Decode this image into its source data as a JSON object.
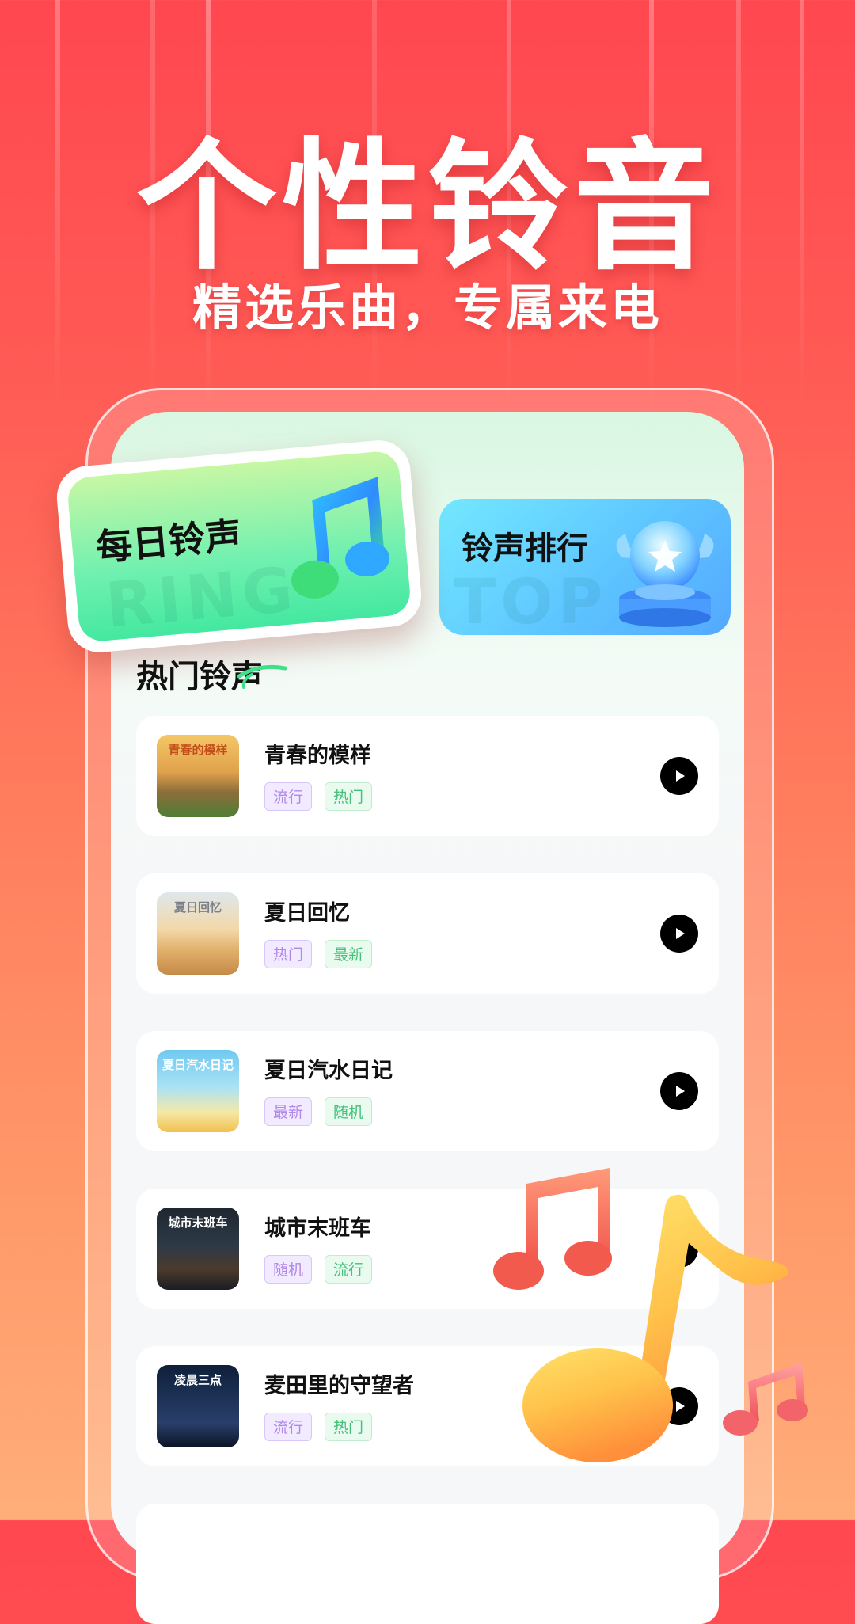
{
  "hero": {
    "title": "个性铃音",
    "subtitle": "精选乐曲，专属来电"
  },
  "cards": {
    "daily": {
      "title": "每日铃声",
      "watermark": "RING",
      "icon": "music-note-icon"
    },
    "ranking": {
      "title": "铃声排行",
      "watermark": "TOP",
      "icon": "trophy-icon"
    }
  },
  "section": {
    "title": "热门铃声"
  },
  "songs": [
    {
      "name": "青春的模样",
      "cover_caption": "青春的模样",
      "tags": [
        "流行",
        "热门"
      ]
    },
    {
      "name": "夏日回忆",
      "cover_caption": "夏日回忆",
      "tags": [
        "热门",
        "最新"
      ]
    },
    {
      "name": "夏日汽水日记",
      "cover_caption": "夏日汽水日记",
      "tags": [
        "最新",
        "随机"
      ]
    },
    {
      "name": "城市末班车",
      "cover_caption": "城市末班车",
      "tags": [
        "随机",
        "流行"
      ]
    },
    {
      "name": "麦田里的守望者",
      "cover_caption": "凌晨三点",
      "tags": [
        "流行",
        "热门"
      ]
    }
  ],
  "icons": {
    "play": "play-icon",
    "decor_note_large": "music-note-icon",
    "decor_note_red": "double-music-note-icon",
    "decor_note_small": "double-music-note-icon"
  },
  "colors": {
    "background_top": "#ff4750",
    "background_bottom": "#ffae7a",
    "tag_purple": "#b088e8",
    "tag_green": "#44c07a"
  }
}
